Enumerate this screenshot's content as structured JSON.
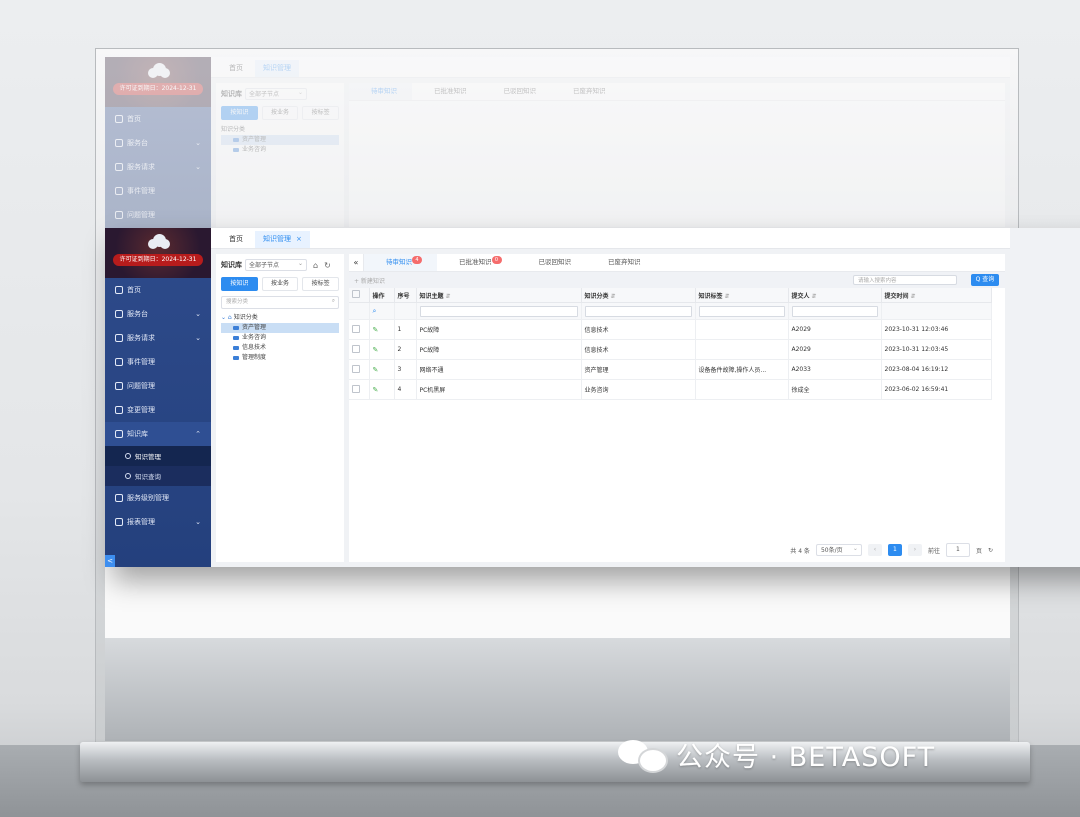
{
  "app": {
    "license": "许可证到期日：2024-12-31",
    "tabs": [
      {
        "label": "首页"
      },
      {
        "label": "知识管理",
        "close": "×"
      }
    ]
  },
  "sidebar": {
    "items": [
      {
        "label": "首页",
        "icon": "home-icon"
      },
      {
        "label": "服务台",
        "icon": "desktop-icon",
        "caret": "⌄"
      },
      {
        "label": "服务请求",
        "icon": "location-icon",
        "caret": "⌄"
      },
      {
        "label": "事件管理",
        "icon": "monitor-icon"
      },
      {
        "label": "问题管理",
        "icon": "box-icon"
      },
      {
        "label": "变更管理",
        "icon": "calendar-icon"
      },
      {
        "label": "知识库",
        "icon": "book-icon",
        "caret": "⌃"
      }
    ],
    "submenu": [
      {
        "label": "知识管理",
        "active": true
      },
      {
        "label": "知识查询"
      }
    ],
    "items_after": [
      {
        "label": "服务级别管理",
        "icon": "level-icon"
      },
      {
        "label": "报表管理",
        "icon": "report-icon",
        "caret": "⌄"
      }
    ],
    "collapse": "<"
  },
  "left_panel": {
    "label": "知识库",
    "select": "全部子节点",
    "segments": [
      "按知识",
      "按业务",
      "按标签"
    ],
    "search_placeholder": "搜索分类",
    "tree_root": "知识分类",
    "tree": [
      "资产管理",
      "业务咨询",
      "信息技术",
      "管理制度"
    ]
  },
  "right_panel": {
    "collapse": "«",
    "tabs": [
      {
        "label": "待审知识",
        "badge": "4"
      },
      {
        "label": "已批准知识",
        "badge": "0"
      },
      {
        "label": "已驳回知识"
      },
      {
        "label": "已废弃知识"
      }
    ],
    "toolbar_text": "+ 新建知识",
    "search_placeholder": "请输入搜索内容",
    "search_button": "Q 查询",
    "columns": [
      "操作",
      "序号",
      "知识主题",
      "知识分类",
      "知识标签",
      "提交人",
      "提交时间"
    ],
    "rows": [
      {
        "no": "1",
        "title": "PC故障",
        "category": "信息技术",
        "tags": "",
        "submitter": "A2029",
        "time": "2023-10-31 12:03:46"
      },
      {
        "no": "2",
        "title": "PC故障",
        "category": "信息技术",
        "tags": "",
        "submitter": "A2029",
        "time": "2023-10-31 12:03:45"
      },
      {
        "no": "3",
        "title": "网络不通",
        "category": "资产管理",
        "tags": "设备备件故障,操作人员...",
        "submitter": "A2033",
        "time": "2023-08-04 16:19:12"
      },
      {
        "no": "4",
        "title": "PC机黑屏",
        "category": "业务咨询",
        "tags": "",
        "submitter": "徐成全",
        "time": "2023-06-02 16:59:41"
      }
    ],
    "pager": {
      "total": "共 4 条",
      "size": "50条/页",
      "page": "1",
      "goto_label": "前往",
      "goto_value": "1",
      "page_unit": "页"
    }
  },
  "watermark": "公众号 · BETASOFT"
}
